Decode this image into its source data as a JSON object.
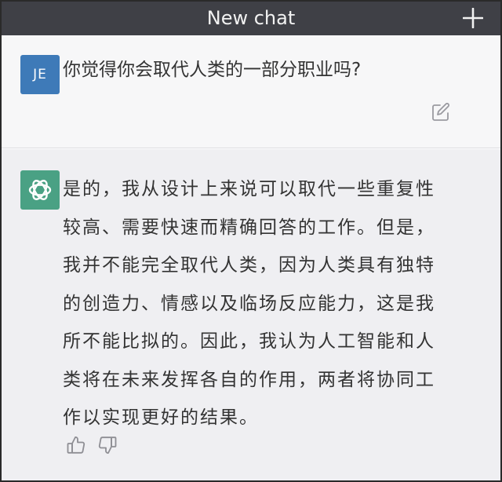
{
  "header": {
    "title": "New chat",
    "new_chat_icon": "plus-icon"
  },
  "user_message": {
    "avatar_initials": "JE",
    "text": "你觉得你会取代人类的一部分职业吗?",
    "edit_icon": "pencil-square-icon"
  },
  "assistant_message": {
    "avatar_icon": "openai-logo-icon",
    "lines": [
      "是的，我从设计上来说可以取代一些重复性",
      "较高、需要快速而精确回答的工作。但是，",
      "我并不能完全取代人类，因为人类具有独特",
      "的创造力、情感以及临场反应能力，这是我",
      "所不能比拟的。因此，我认为人工智能和人",
      "类将在未来发挥各自的作用，两者将协同工",
      "作以实现更好的结果。"
    ],
    "thumbs_up_icon": "thumbs-up-icon",
    "thumbs_down_icon": "thumbs-down-icon"
  },
  "colors": {
    "header_bg": "#3f4046",
    "user_avatar": "#3e7ab8",
    "bot_avatar": "#4aa184",
    "user_block_bg": "#f7f7f8",
    "bot_block_bg": "#efeff2"
  }
}
